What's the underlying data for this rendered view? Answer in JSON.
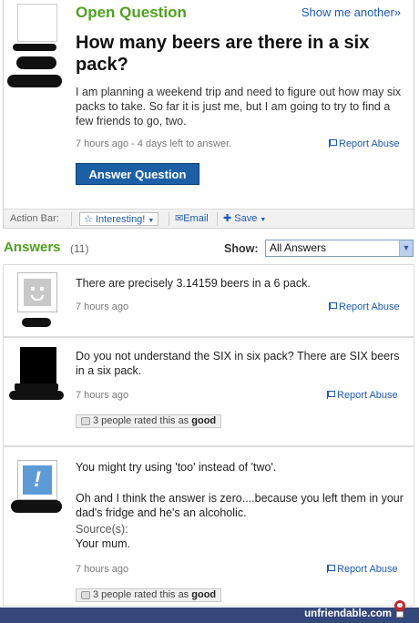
{
  "question": {
    "status_label": "Open Question",
    "show_another": "Show me another»",
    "title": "How many beers are there in a six pack?",
    "body": "I am planning a weekend trip and need to figure out how may six packs to take. So far it is just me, but I am going to try to find a few friends to go, two.",
    "meta": "7 hours ago - 4 days left to answer.",
    "report_label": "Report Abuse",
    "answer_button": "Answer Question"
  },
  "action_bar": {
    "label": "Action Bar:",
    "interesting": "Interesting!",
    "email": "Email",
    "save": "Save"
  },
  "answers_header": {
    "title": "Answers",
    "count": "(11)",
    "show_label": "Show:",
    "filter_value": "All Answers"
  },
  "answers": [
    {
      "text": "There are precisely 3.14159 beers in a 6 pack.",
      "time": "7 hours ago",
      "report": "Report Abuse"
    },
    {
      "text": "Do you not understand the SIX in six pack? There are SIX beers in a six pack.",
      "time": "7 hours ago",
      "report": "Report Abuse",
      "rating_prefix": "3 people rated this as",
      "rating_word": "good"
    },
    {
      "text_1": "You might try using 'too' instead of 'two'.",
      "text_2": "Oh and I think the answer is zero....because you left them in your dad's fridge and he's an alcoholic.",
      "sources_label": "Source(s):",
      "source": "Your mum.",
      "time": "7 hours ago",
      "report": "Report Abuse",
      "rating_prefix": "3 people rated this as",
      "rating_word": "good"
    }
  ],
  "footer": {
    "brand": "unfriendable.com"
  },
  "colors": {
    "green": "#4ea21f",
    "link_blue": "#1b5bb5",
    "button_blue": "#1c5fa6",
    "footer_bg": "#34477a"
  }
}
